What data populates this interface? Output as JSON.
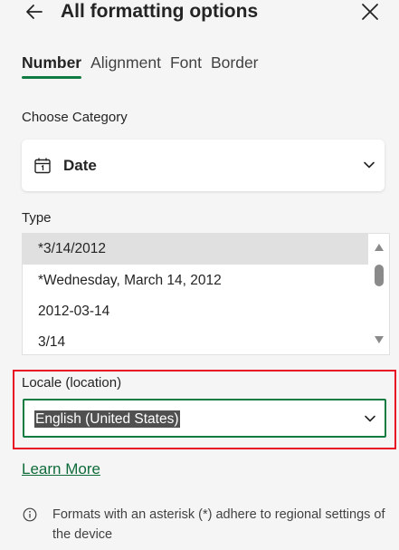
{
  "header": {
    "title": "All formatting options",
    "back_icon": "back-arrow-icon",
    "close_icon": "close-icon"
  },
  "tabs": [
    {
      "label": "Number",
      "active": true
    },
    {
      "label": "Alignment",
      "active": false
    },
    {
      "label": "Font",
      "active": false
    },
    {
      "label": "Border",
      "active": false
    }
  ],
  "category": {
    "label": "Choose Category",
    "value": "Date",
    "icon": "calendar-icon"
  },
  "type": {
    "label": "Type",
    "items": [
      "*3/14/2012",
      "*Wednesday, March 14, 2012",
      "2012-03-14",
      "3/14"
    ],
    "selected_index": 0
  },
  "locale": {
    "label": "Locale (location)",
    "value": "English (United States)"
  },
  "learn_more": "Learn More",
  "info": {
    "icon": "info-icon",
    "text": "Formats with an asterisk (*) adhere to regional settings of the device"
  },
  "colors": {
    "accent": "#107c41",
    "highlight_box": "#e81123",
    "background": "#f5f5f5"
  }
}
